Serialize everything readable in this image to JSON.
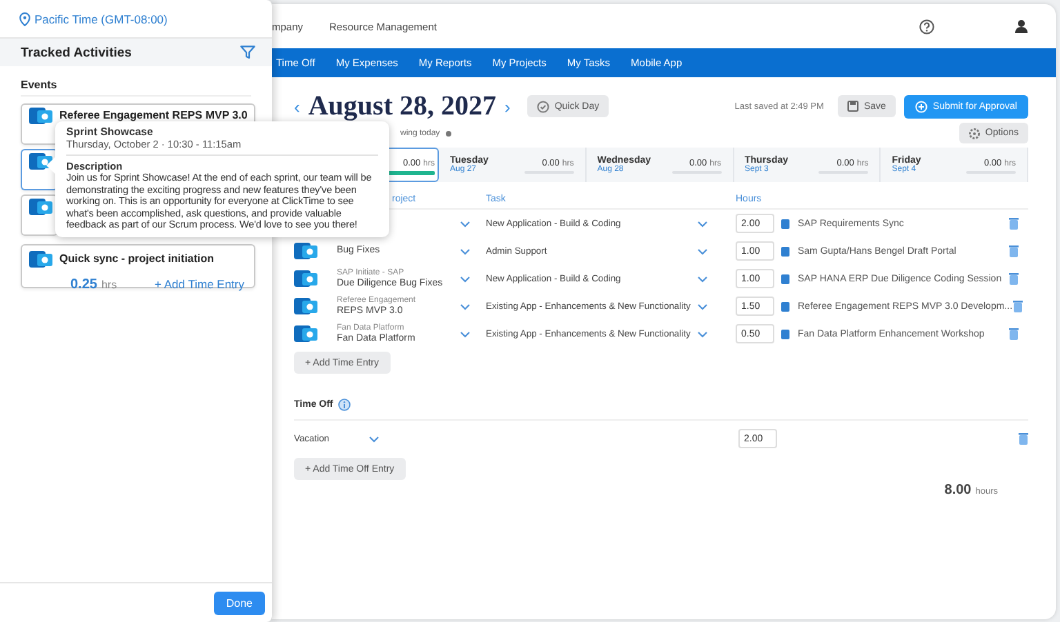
{
  "panel": {
    "timezone": "Pacific Time (GMT-08:00)",
    "title": "Tracked Activities",
    "section": "Events",
    "events": [
      {
        "title": "Referee Engagement REPS MVP 3.0",
        "selected": false
      },
      {
        "selected": true
      },
      {
        "selected": false
      },
      {
        "title": "Quick sync - project initiation",
        "hours": "0.25",
        "unit": "hrs",
        "action": "+ Add Time Entry",
        "selected": false
      }
    ],
    "done": "Done"
  },
  "tooltip": {
    "title": "Sprint Showcase",
    "when": "Thursday, October 2 · 10:30 - 11:15am",
    "heading": "Description",
    "body": "Join us for Sprint Showcase! At the end of each sprint, our team will be demonstrating the exciting progress and new features they've been working on. This is an opportunity for everyone at ClickTime to see what's been accomplished, ask questions, and provide valuable feedback as part of our Scrum process. We'd love to see you there!"
  },
  "app": {
    "top_nav": [
      "mpany",
      "Resource Management"
    ],
    "tabs": [
      "Time Off",
      "My Expenses",
      "My Reports",
      "My Projects",
      "My Tasks",
      "Mobile App"
    ],
    "prev": "‹",
    "date": "August 28, 2027",
    "next": "›",
    "quick_day": "Quick Day",
    "last_saved": "Last saved at 2:49 PM",
    "save": "Save",
    "submit": "Submit for Approval",
    "showing": "wing today",
    "options": "Options",
    "days": [
      {
        "total": "0.00",
        "unit": "hrs",
        "selected": true
      },
      {
        "name": "Tuesday",
        "date": "Aug 27",
        "total": "0.00",
        "unit": "hrs",
        "selected": false
      },
      {
        "name": "Wednesday",
        "date": "Aug 28",
        "total": "0.00",
        "unit": "hrs",
        "selected": false
      },
      {
        "name": "Thursday",
        "date": "Sept 3",
        "total": "0.00",
        "unit": "hrs",
        "selected": false
      },
      {
        "name": "Friday",
        "date": "Sept 4",
        "total": "0.00",
        "unit": "hrs",
        "selected": false
      }
    ],
    "columns": [
      "roject",
      "Task",
      "Hours"
    ],
    "rows": [
      {
        "task": "New Application - Build & Coding",
        "hours": "2.00",
        "note": "SAP Requirements Sync"
      },
      {
        "project": "Bug Fixes",
        "task": "Admin Support",
        "hours": "1.00",
        "note": "Sam Gupta/Hans Bengel Draft Portal"
      },
      {
        "client": "SAP Initiate - SAP",
        "project": "Due Diligence Bug Fixes",
        "task": "New Application - Build & Coding",
        "hours": "1.00",
        "note": "SAP HANA ERP Due Diligence Coding Session"
      },
      {
        "client": "Referee Engagement",
        "project": "REPS MVP 3.0",
        "task": "Existing App - Enhancements & New Functionality",
        "hours": "1.50",
        "note": "Referee Engagement REPS MVP 3.0 Developm..."
      },
      {
        "client": "Fan Data Platform",
        "project": "Fan Data Platform",
        "task": "Existing App - Enhancements & New Functionality",
        "hours": "0.50",
        "note": "Fan Data Platform Enhancement Workshop"
      }
    ],
    "add_entry": "+ Add Time Entry",
    "time_off": {
      "title": "Time Off",
      "entries": [
        {
          "type": "Vacation",
          "hours": "2.00"
        }
      ],
      "add": "+ Add Time Off Entry"
    },
    "total": {
      "value": "8.00",
      "unit": "hours"
    }
  }
}
